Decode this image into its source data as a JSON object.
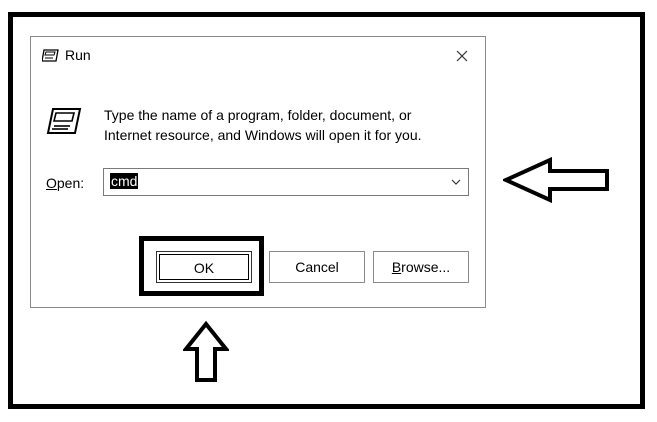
{
  "dialog": {
    "title": "Run",
    "description_line1": "Type the name of a program, folder, document, or",
    "description_line2": "Internet resource, and Windows will open it for you.",
    "open_label_mnemonic": "O",
    "open_label_rest": "pen:",
    "open_value": "cmd",
    "buttons": {
      "ok": "OK",
      "cancel": "Cancel",
      "browse_mnemonic": "B",
      "browse_rest": "rowse..."
    }
  },
  "icons": {
    "title_icon": "run-icon",
    "close_icon": "close-icon",
    "dropdown_icon": "chevron-down-icon"
  }
}
